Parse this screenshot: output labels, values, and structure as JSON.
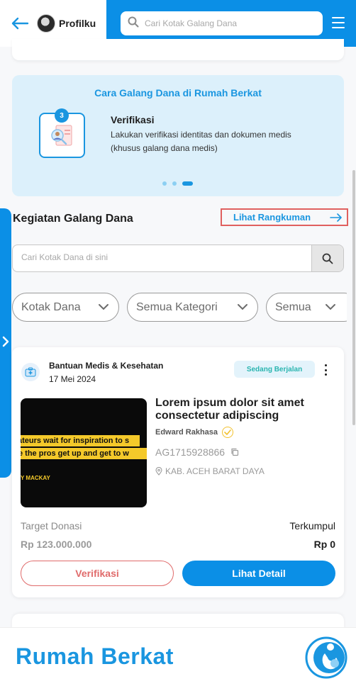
{
  "header": {
    "profile_label": "Profilku",
    "search_placeholder": "Cari Kotak Galang Dana"
  },
  "banner": {
    "title": "Cara Galang Dana di Rumah Berkat",
    "step_number": "3",
    "step_title": "Verifikasi",
    "step_description": "Lakukan verifikasi identitas dan dokumen medis (khusus galang dana medis)",
    "slide_count": 3,
    "active_slide": 3
  },
  "section": {
    "title": "Kegiatan Galang Dana",
    "summary_link": "Lihat Rangkuman",
    "search_placeholder": "Cari Kotak Dana di sini"
  },
  "filters": [
    {
      "label": "Kotak Dana"
    },
    {
      "label": "Semua Kategori"
    },
    {
      "label": "Semua"
    }
  ],
  "campaign": {
    "category": "Bantuan Medis & Kesehatan",
    "date": "17 Mei 2024",
    "status": "Sedang Berjalan",
    "title": "Lorem ipsum dolor sit amet consectetur adipiscing",
    "author": "Edward Rakhasa",
    "code": "AG1715928866",
    "location": "KAB. ACEH BARAT DAYA",
    "thumbnail_line1": "ateurs wait for inspiration to s",
    "thumbnail_line2": "e the pros get up and get to w",
    "thumbnail_author": "Y MACKAY",
    "target_label": "Target Donasi",
    "target_value": "Rp 123.000.000",
    "collected_label": "Terkumpul",
    "collected_value": "Rp 0",
    "verify_button": "Verifikasi",
    "detail_button": "Lihat Detail"
  },
  "footer": {
    "brand": "Rumah Berkat"
  },
  "colors": {
    "primary": "#0b8fe6",
    "banner_bg": "#dcf0fb",
    "status_text": "#2ab5b0",
    "verify_red": "#e06b6b",
    "highlight_border": "#e0605f"
  }
}
